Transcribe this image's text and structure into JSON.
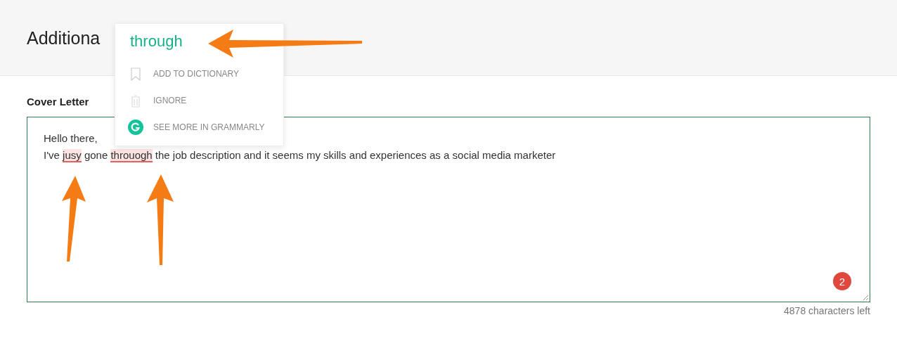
{
  "header": {
    "title": "Additiona"
  },
  "field": {
    "label": "Cover Letter",
    "lines": [
      [
        {
          "text": "Hello there,",
          "flagged": false
        }
      ],
      [
        {
          "text": "I've ",
          "flagged": false
        },
        {
          "text": "jusy",
          "flagged": true
        },
        {
          "text": " gone ",
          "flagged": false
        },
        {
          "text": "throuogh",
          "flagged": true
        },
        {
          "text": " the job description and it seems my skills and experiences as a social media marketer",
          "flagged": false
        }
      ]
    ],
    "issue_count": "2",
    "counter": "4878 characters left"
  },
  "popup": {
    "suggestion": "through",
    "actions": [
      {
        "kind": "bookmark",
        "label": "ADD TO DICTIONARY"
      },
      {
        "kind": "trash",
        "label": "IGNORE"
      },
      {
        "kind": "grammarly",
        "label": "SEE MORE IN GRAMMARLY"
      }
    ]
  }
}
